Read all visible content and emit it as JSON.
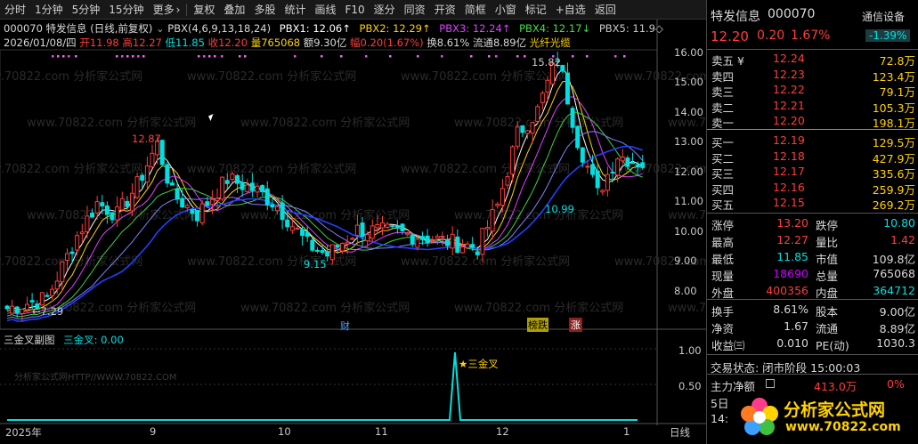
{
  "toolbar": {
    "items": [
      "分时",
      "1分钟",
      "5分钟",
      "15分钟",
      "更多",
      "复权",
      "叠加",
      "多股",
      "统计",
      "画线",
      "F10",
      "逐分",
      "同资",
      "开资",
      "简框",
      "小窗",
      "标记",
      "+自选",
      "返回"
    ],
    "more_arrow": "›"
  },
  "header": {
    "code_name": "000070 特发信息 (日线,前复权)",
    "indicator": "PBX(4,6,9,13,18,24)",
    "pbx1": "PBX1: 12.06↑",
    "pbx2": "PBX2: 12.29↑",
    "pbx3": "PBX3: 12.24↑",
    "pbx4": "PBX4: 12.17↓",
    "pbx5": "PBX5: 11.9◇"
  },
  "bar_info": {
    "date": "2026/01/08/四",
    "open": "开11.98",
    "high": "高12.27",
    "low": "低11.85",
    "close": "收12.20",
    "volume": "量765068",
    "amount": "额9.30亿",
    "range": "幅0.20(1.67%)",
    "turnover": "换8.61%",
    "float": "流通8.89亿",
    "concept": "光纤光缆"
  },
  "watermark": "www.70822.com 分析家公式网",
  "price_labels": {
    "p1": "12.87",
    "p2": "15.82",
    "p3": "10.99",
    "p4": "9.15",
    "p5": "←7.29"
  },
  "y_axis": [
    "16.00",
    "15.00",
    "14.00",
    "13.00",
    "12.00",
    "11.00",
    "10.00",
    "9.00",
    "8.00"
  ],
  "x_axis": [
    "2025年",
    "9",
    "10",
    "11",
    "12",
    "1",
    "日线"
  ],
  "events": {
    "cai": "财",
    "bang": "榜跌",
    "zhang": "涨"
  },
  "sub_chart": {
    "title": "三金叉副图",
    "series": "三金叉: 0.00",
    "signal": "★三金叉",
    "y": [
      "1.00",
      "0.50"
    ],
    "watermark": "分析家公式网HTTP//WWW.70822.COM"
  },
  "right_panel": {
    "name": "特发信息",
    "code": "000070",
    "setting": "通信设备",
    "price": "12.20",
    "change": "0.20",
    "pct": "1.67%",
    "sector_pct": "-1.39%",
    "asks": [
      {
        "label": "卖五 ¥",
        "price": "12.24",
        "vol": "72.8万"
      },
      {
        "label": "卖四",
        "price": "12.23",
        "vol": "123.4万"
      },
      {
        "label": "卖三",
        "price": "12.22",
        "vol": "79.1万"
      },
      {
        "label": "卖二",
        "price": "12.21",
        "vol": "105.3万"
      },
      {
        "label": "卖一",
        "price": "12.20",
        "vol": "198.1万"
      }
    ],
    "bids": [
      {
        "label": "买一",
        "price": "12.19",
        "vol": "129.5万"
      },
      {
        "label": "买二",
        "price": "12.18",
        "vol": "427.9万"
      },
      {
        "label": "买三",
        "price": "12.17",
        "vol": "335.6万"
      },
      {
        "label": "买四",
        "price": "12.16",
        "vol": "259.9万"
      },
      {
        "label": "买五",
        "price": "12.15",
        "vol": "269.2万"
      }
    ],
    "stats": [
      {
        "l1": "涨停",
        "v1": "13.20",
        "l2": "跌停",
        "v2": "10.80"
      },
      {
        "l1": "最高",
        "v1": "12.27",
        "l2": "量比",
        "v2": "1.42"
      },
      {
        "l1": "最低",
        "v1": "11.85",
        "l2": "市值",
        "v2": "109.8亿"
      },
      {
        "l1": "现量",
        "v1": "18690",
        "l2": "总量",
        "v2": "765068"
      },
      {
        "l1": "外盘",
        "v1": "400356",
        "l2": "内盘",
        "v2": "364712"
      }
    ],
    "stats2": [
      {
        "l1": "换手",
        "v1": "8.61%",
        "l2": "股本",
        "v2": "9.00亿"
      },
      {
        "l1": "净资",
        "v1": "1.67",
        "l2": "流通",
        "v2": "8.89亿"
      },
      {
        "l1": "收益㈢",
        "v1": "0.010",
        "l2": "PE(动)",
        "v2": "1030.3"
      }
    ],
    "trade_state": "交易状态: 闭市阶段 15:00:03",
    "main_net": {
      "label": "主力净额",
      "value": "413.0万",
      "pct": "0%"
    },
    "date_label": "5日",
    "time_label": "14:",
    "logo": {
      "title": "分析家公式网",
      "url": "www.70822.com"
    }
  }
}
